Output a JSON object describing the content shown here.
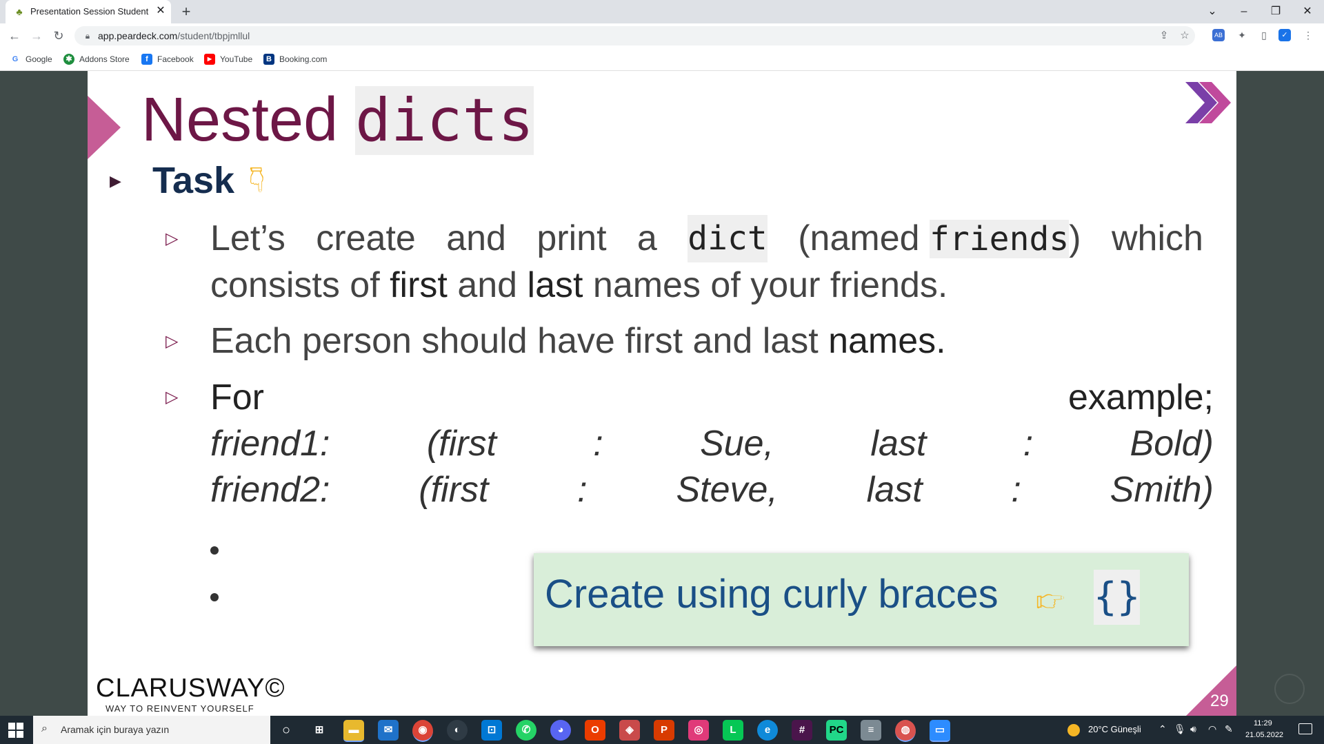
{
  "browser": {
    "tab_title": "Presentation Session Student",
    "tab_close": "✕",
    "new_tab": "+",
    "url_domain": "app.peardeck.com",
    "url_path": "/student/tbpjmllul",
    "bookmarks": [
      {
        "label": "Google",
        "icon": "google-icon",
        "color": "#4285f4"
      },
      {
        "label": "Addons Store",
        "icon": "addons-store-icon",
        "color": "#1e8e3e"
      },
      {
        "label": "Facebook",
        "icon": "facebook-icon",
        "color": "#1877f2"
      },
      {
        "label": "YouTube",
        "icon": "youtube-icon",
        "color": "#ff0000"
      },
      {
        "label": "Booking.com",
        "icon": "booking-icon",
        "color": "#003580"
      }
    ]
  },
  "slide": {
    "title_plain": "Nested ",
    "title_code": "dicts",
    "task_label": "Task",
    "bullet1": {
      "p1": "Let’s",
      "p2": "create",
      "p3": "and",
      "p4": "print",
      "p5": "a",
      "code1": "dict",
      "p6": "(named",
      "code2": "friends",
      "p7": ")",
      "p8": "which",
      "line2_a": "consists of ",
      "line2_b": "first",
      "line2_c": " and ",
      "line2_d": "last",
      "line2_e": " names of your friends."
    },
    "bullet2": {
      "text": "Each person should have first and last ",
      "bold": "names."
    },
    "bullet3": {
      "for": "For",
      "example": "example;",
      "row1": [
        "friend1:",
        "(first",
        ":",
        "Sue,",
        "last",
        ":",
        "Bold)"
      ],
      "row2": [
        "friend2:",
        "(first",
        ":",
        "Steve,",
        "last",
        ":",
        "Smith)"
      ]
    },
    "callout": {
      "text": "Create using curly braces",
      "braces": "{}"
    },
    "brand": "CLARUSWAY©",
    "tagline": "WAY TO REINVENT YOURSELF",
    "page_number": "29"
  },
  "taskbar": {
    "search_placeholder": "Aramak için buraya yazın",
    "weather": "20°C  Güneşli",
    "time": "11:29",
    "date": "21.05.2022"
  },
  "colors": {
    "title": "#6d1746",
    "accent_pink": "#c65d96",
    "task": "#152d4f",
    "callout_bg": "#d9eed9",
    "callout_text": "#1a4f86"
  }
}
